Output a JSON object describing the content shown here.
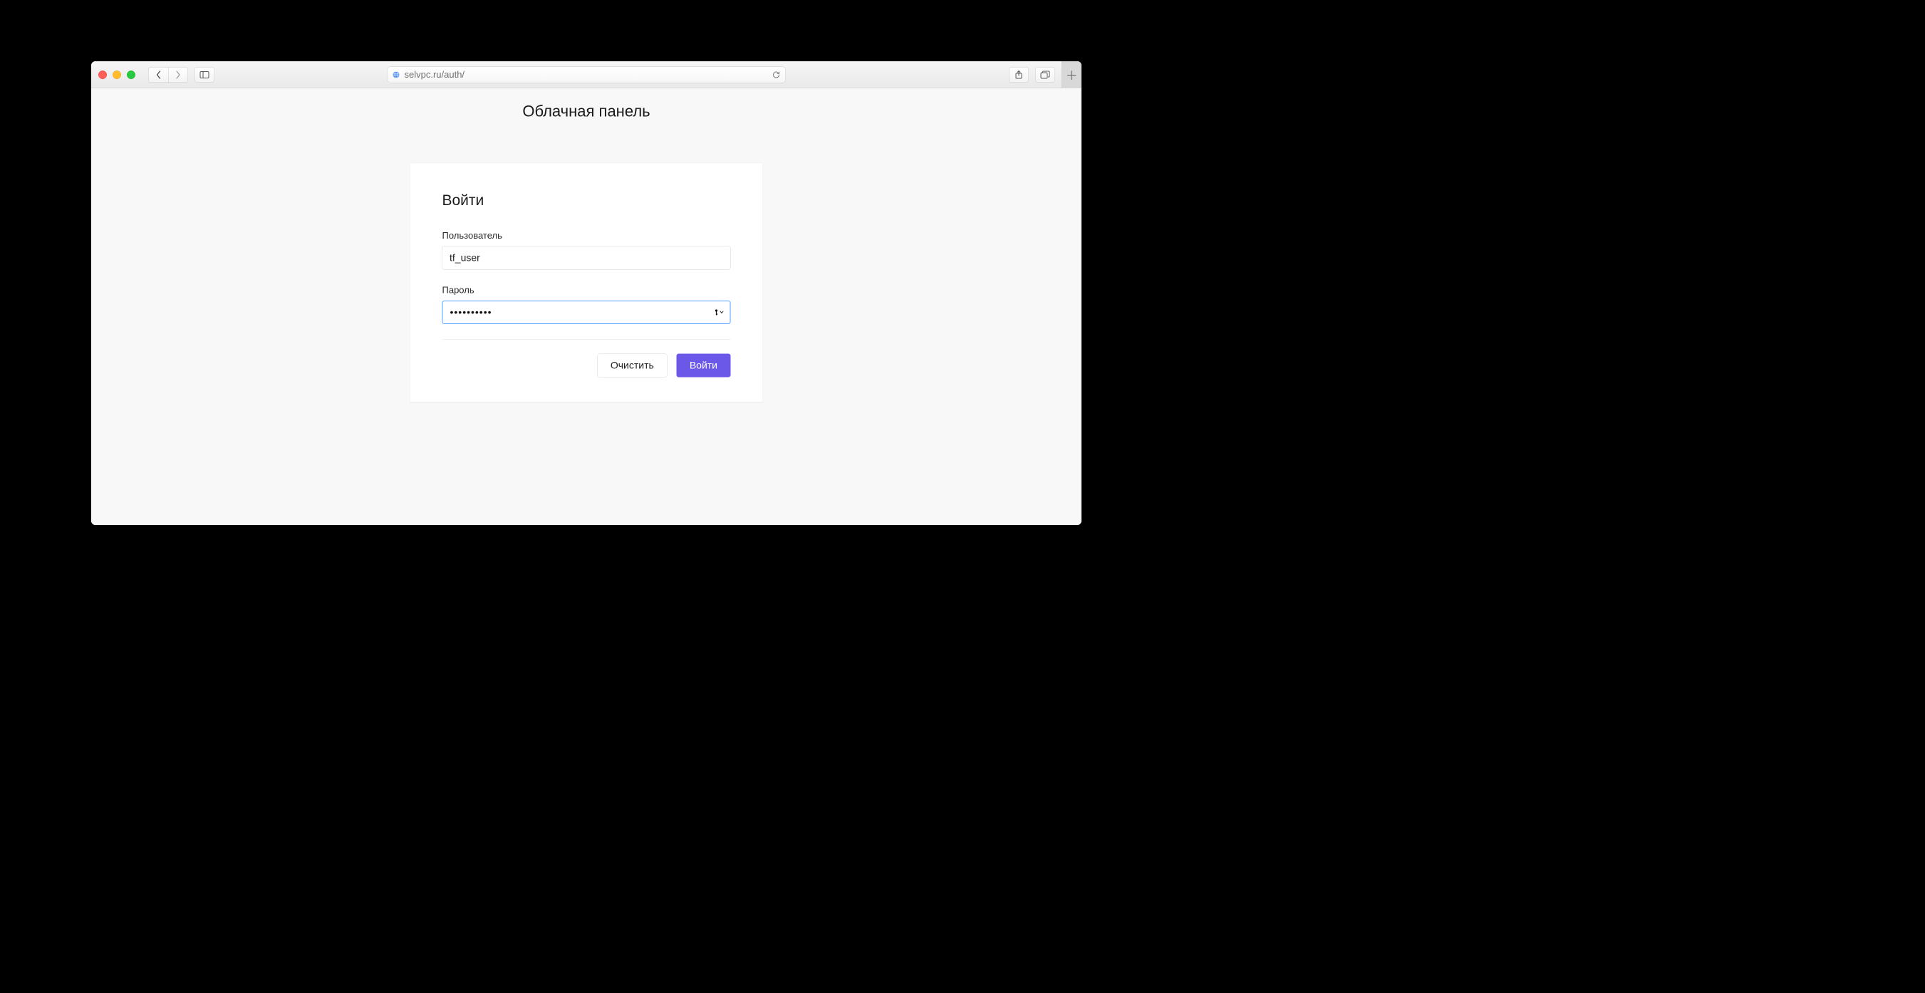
{
  "browser": {
    "url": "selvpc.ru/auth/"
  },
  "page": {
    "title": "Облачная панель"
  },
  "card": {
    "title": "Войти",
    "username_label": "Пользователь",
    "username_value": "tf_user",
    "password_label": "Пароль",
    "password_value": "••••••••••",
    "clear_label": "Очистить",
    "submit_label": "Войти"
  },
  "colors": {
    "primary": "#6b57e8",
    "focus_border": "#4da3ff"
  }
}
